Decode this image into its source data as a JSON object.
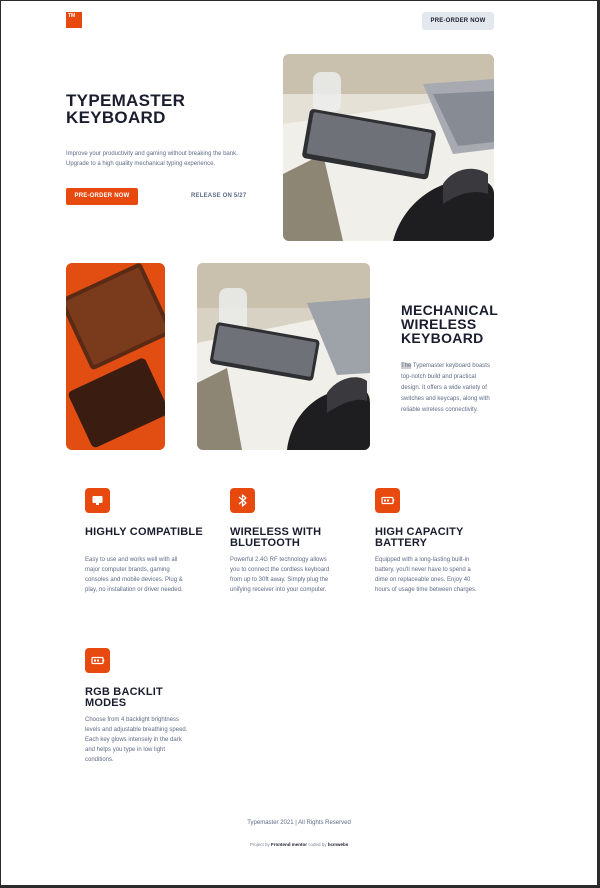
{
  "header": {
    "logo_text": "TM",
    "preorder_label": "PRE-ORDER NOW"
  },
  "hero": {
    "title": "TYPEMASTER KEYBOARD",
    "description": "Improve your productivity and gaming without breaking the bank. Upgrade to a high quality mechanical typing experience.",
    "preorder_label": "PRE-ORDER NOW",
    "release_label": "RELEASE ON 5/27"
  },
  "section": {
    "title": "MECHANICAL WIRELESS KEYBOARD",
    "desc_highlight": "The",
    "description": " Typemaster keyboard boasts top-notch build and practical design. It offers a wide variety of switches and keycaps, along with reliable wireless connectivity."
  },
  "features": [
    {
      "icon": "monitor-icon",
      "title": "HIGHLY COMPATIBLE",
      "description": "Easy to use and works well with all major computer brands, gaming consoles and mobile devices. Plug & play, no installation or driver needed."
    },
    {
      "icon": "bluetooth-icon",
      "title": "WIRELESS WITH BLUETOOTH",
      "description": "Powerful 2.4G RF technology allows you to connect the cordless keyboard from up to 30ft away. Simply plug the unifying receiver into your computer."
    },
    {
      "icon": "battery-icon",
      "title": "HIGH CAPACITY BATTERY",
      "description": "Equipped with a long-lasting built-in battery, you'll never have to spend a dime on replaceable ones.  Enjoy 40 hours of usage time between charges."
    },
    {
      "icon": "battery-icon",
      "title": "RGB BACKLIT MODES",
      "description": "Choose from 4 backlight brightness levels and adjustable breathing speed. Each key glows intensely in the dark and helps you type in low light conditions."
    }
  ],
  "footer": {
    "copyright": "Typemaster 2021 | All Rights Reserved",
    "credit_prefix": "Project by ",
    "credit_project": "Frontend mentor",
    "credit_middle": " coded by ",
    "credit_author": "hcmwebs"
  },
  "colors": {
    "accent": "#e8490f",
    "dark": "#1a1d2e",
    "muted": "#5f6b86",
    "button_light": "#e3e8ee"
  }
}
